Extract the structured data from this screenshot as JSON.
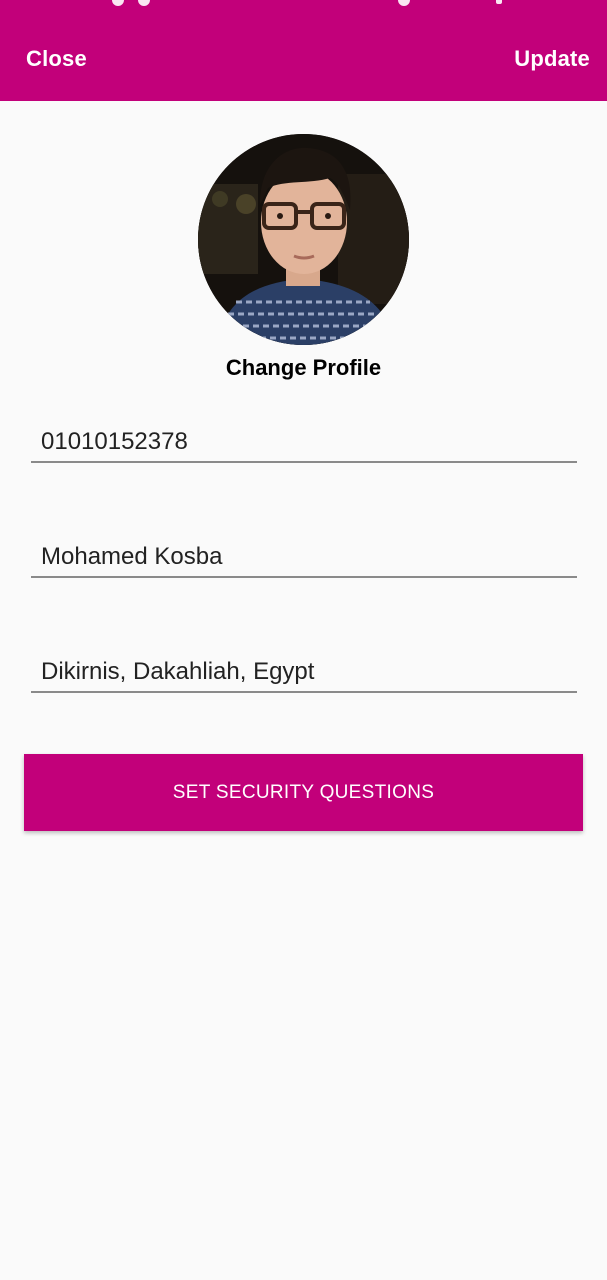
{
  "header": {
    "close_label": "Close",
    "update_label": "Update",
    "background_color": "#c2007a"
  },
  "profile": {
    "change_profile_label": "Change Profile"
  },
  "form": {
    "phone": "01010152378",
    "name": "Mohamed Kosba",
    "address": "Dikirnis, Dakahliah, Egypt"
  },
  "actions": {
    "security_questions_label": "SET SECURITY QUESTIONS"
  }
}
